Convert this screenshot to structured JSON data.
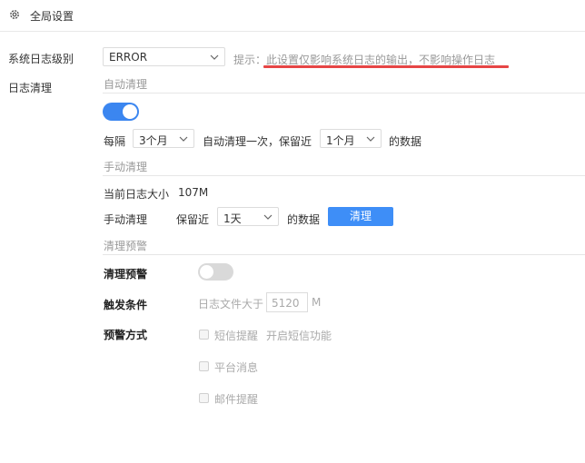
{
  "header": {
    "title": "全局设置",
    "icon": "gear-icon"
  },
  "log_level": {
    "label": "系统日志级别",
    "selected": "ERROR",
    "hint": "提示：此设置仅影响系统日志的输出，不影响操作日志"
  },
  "log_clean": {
    "label": "日志清理",
    "auto": {
      "section": "自动清理",
      "enabled": true,
      "every_label": "每隔",
      "interval": "3个月",
      "mid_text": "自动清理一次，保留近",
      "keep": "1个月",
      "suffix": "的数据"
    },
    "manual": {
      "section": "手动清理",
      "size_label": "当前日志大小",
      "size_value": "107M",
      "clean_label": "手动清理",
      "keep_label": "保留近",
      "keep": "1天",
      "suffix": "的数据",
      "button": "清理"
    },
    "warning": {
      "section": "清理预警",
      "toggle_label": "清理预警",
      "enabled": false,
      "cond_label": "触发条件",
      "cond_text": "日志文件大于",
      "cond_value": "5120",
      "cond_unit": "M",
      "method_label": "预警方式",
      "sms": "短信提醒",
      "sms_link": "开启短信功能",
      "platform": "平台消息",
      "email": "邮件提醒"
    }
  },
  "colors": {
    "accent": "#3b86f0",
    "underline": "#e64545"
  }
}
